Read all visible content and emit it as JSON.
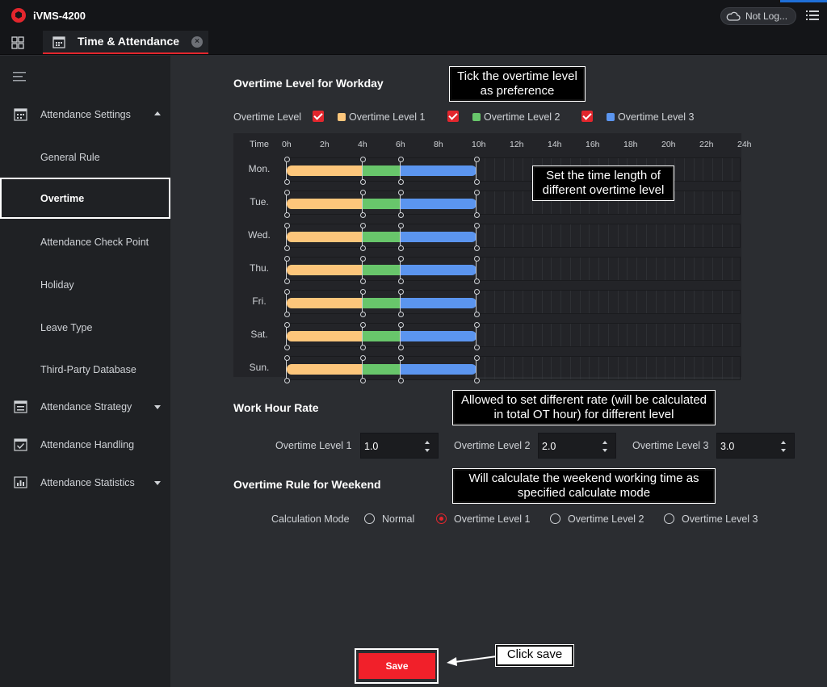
{
  "app": {
    "title": "iVMS-4200",
    "login_label": "Not Log..."
  },
  "tab": {
    "label": "Time & Attendance"
  },
  "sidebar": {
    "groups": [
      {
        "label": "Attendance Settings",
        "expanded": true
      },
      {
        "label": "Attendance Strategy",
        "expanded": false
      },
      {
        "label": "Attendance Handling"
      },
      {
        "label": "Attendance Statistics",
        "expanded": false
      }
    ],
    "items": [
      "General Rule",
      "Overtime",
      "Attendance Check Point",
      "Holiday",
      "Leave Type",
      "Third-Party Database"
    ],
    "active_item": "Overtime"
  },
  "workday": {
    "title": "Overtime Level for Workday",
    "overtime_level_label": "Overtime Level",
    "levels": [
      {
        "label": "Overtime Level 1",
        "checked": true,
        "color": "#fdc67b"
      },
      {
        "label": "Overtime Level 2",
        "checked": true,
        "color": "#68c66b"
      },
      {
        "label": "Overtime Level 3",
        "checked": true,
        "color": "#5b95ef"
      }
    ],
    "schedule": {
      "time_header": "Time",
      "hours": [
        "0h",
        "2h",
        "4h",
        "6h",
        "8h",
        "10h",
        "12h",
        "14h",
        "16h",
        "18h",
        "20h",
        "22h",
        "24h"
      ],
      "days": [
        "Mon.",
        "Tue.",
        "Wed.",
        "Thu.",
        "Fri.",
        "Sat.",
        "Sun."
      ],
      "segments_hours": [
        [
          0,
          4
        ],
        [
          4,
          6
        ],
        [
          6,
          10
        ]
      ]
    }
  },
  "rate": {
    "title": "Work Hour Rate",
    "fields": [
      {
        "label": "Overtime Level 1",
        "value": "1.0"
      },
      {
        "label": "Overtime Level 2",
        "value": "2.0"
      },
      {
        "label": "Overtime Level 3",
        "value": "3.0"
      }
    ]
  },
  "weekend": {
    "title": "Overtime Rule for Weekend",
    "calc_label": "Calculation Mode",
    "options": [
      "Normal",
      "Overtime Level 1",
      "Overtime Level 2",
      "Overtime Level 3"
    ],
    "selected": "Overtime Level 1"
  },
  "save_label": "Save",
  "callouts": {
    "tick": "Tick the overtime level as preference",
    "time": "Set the time length of different overtime level",
    "rate": "Allowed to set different rate (will be calculated in total OT hour) for different level",
    "weekend": "Will calculate  the weekend working time as specified calculate mode",
    "save": "Click save"
  }
}
